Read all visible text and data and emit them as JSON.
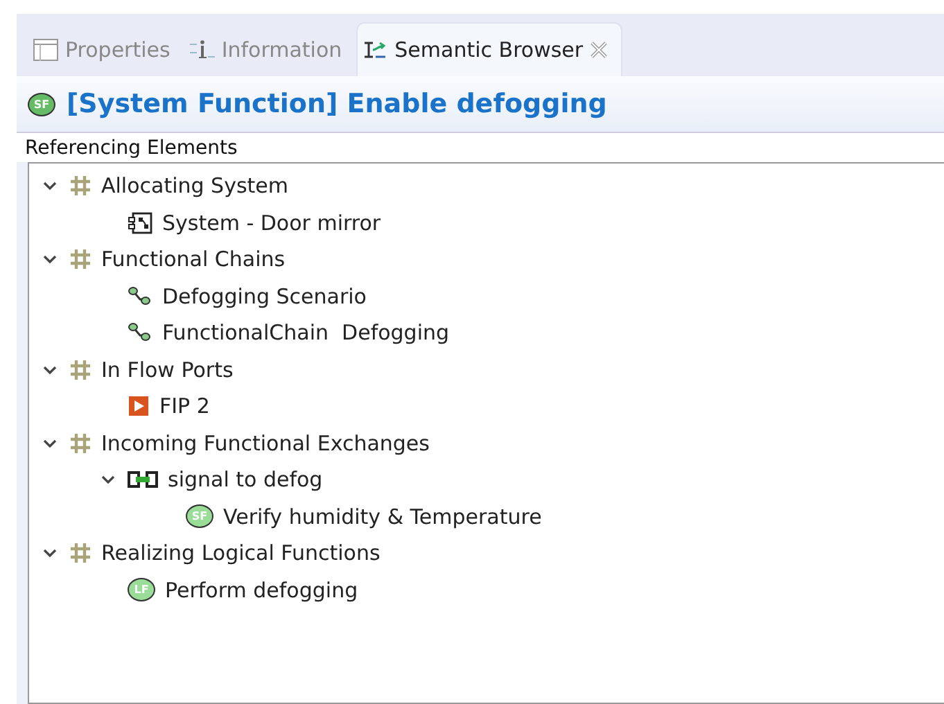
{
  "tabs": [
    {
      "label": "Properties",
      "kind": "table",
      "selected": false
    },
    {
      "label": "Information",
      "kind": "info",
      "selected": false
    },
    {
      "label": "Semantic Browser",
      "kind": "browser",
      "selected": true,
      "closable": true
    }
  ],
  "header": {
    "badge": "SF",
    "title": "[System Function] Enable defogging"
  },
  "section": {
    "title": "Referencing Elements"
  },
  "tree": [
    {
      "label": "Allocating System",
      "kind": "category",
      "expanded": true,
      "children": [
        {
          "label": "System - Door mirror",
          "kind": "system"
        }
      ]
    },
    {
      "label": "Functional Chains",
      "kind": "category",
      "expanded": true,
      "children": [
        {
          "label": "Defogging Scenario",
          "kind": "chain"
        },
        {
          "label": "FunctionalChain  Defogging",
          "kind": "chain"
        }
      ]
    },
    {
      "label": "In Flow Ports",
      "kind": "category",
      "expanded": true,
      "children": [
        {
          "label": "FIP 2",
          "kind": "port"
        }
      ]
    },
    {
      "label": "Incoming Functional Exchanges",
      "kind": "category",
      "expanded": true,
      "children": [
        {
          "label": "signal to defog",
          "kind": "exchange",
          "expanded": true,
          "children": [
            {
              "label": "Verify humidity & Temperature",
              "kind": "function",
              "badge": "SF"
            }
          ]
        }
      ]
    },
    {
      "label": "Realizing Logical Functions",
      "kind": "category",
      "expanded": true,
      "children": [
        {
          "label": "Perform defogging",
          "kind": "function",
          "badge": "LF"
        }
      ]
    }
  ]
}
